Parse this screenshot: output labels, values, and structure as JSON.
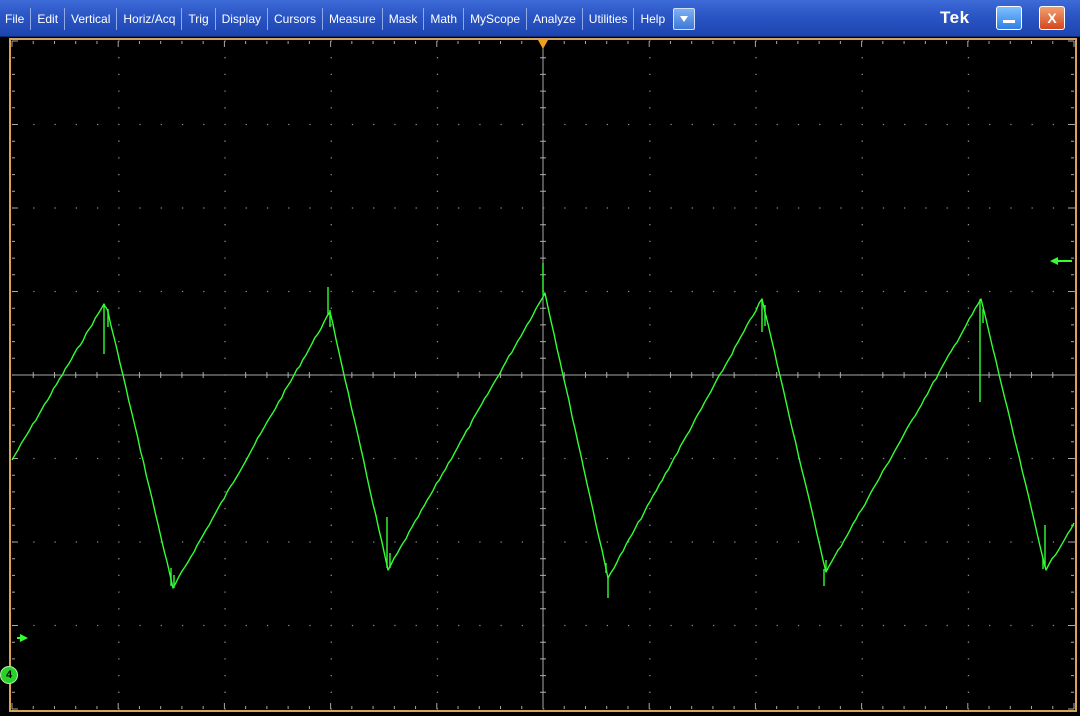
{
  "menubar": {
    "items": [
      "File",
      "Edit",
      "Vertical",
      "Horiz/Acq",
      "Trig",
      "Display",
      "Cursors",
      "Measure",
      "Mask",
      "Math",
      "MyScope",
      "Analyze",
      "Utilities",
      "Help"
    ],
    "brand": "Tek",
    "dropdown_icon": "chevron-down-icon",
    "minimize_icon": "minimize-icon",
    "close_label": "X"
  },
  "display": {
    "channel_number": "4",
    "colors": {
      "trace": "#33ff33",
      "graticule": "#a8a8a8",
      "frame": "#d9a35a",
      "trigger_marker": "#f0a020",
      "channel": "#2ad02a"
    },
    "divisions": {
      "horizontal": 10,
      "vertical": 8
    },
    "trigger_level_marker": "left-arrow-icon",
    "trigger_position_marker": "down-triangle-icon",
    "channel_marker_icon": "right-arrow-icon"
  }
}
